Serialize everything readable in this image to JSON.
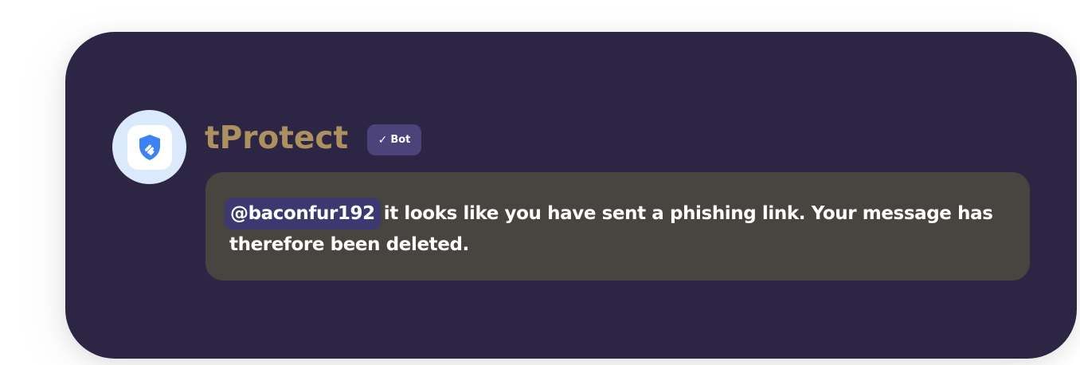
{
  "bot": {
    "name": "tProtect",
    "badge_check": "✓",
    "badge_label": "Bot",
    "avatar_icon": "shield-icon",
    "name_color": "#ad9060"
  },
  "message": {
    "mention": "@baconfur192",
    "text": "it looks like you have sent a phishing link. Your message has therefore been deleted."
  },
  "colors": {
    "card_background": "#2c2544",
    "bubble_background": "#484541",
    "badge_background": "#4b4379",
    "mention_background": "#3d3970",
    "shield_blue": "#3b82f6"
  }
}
